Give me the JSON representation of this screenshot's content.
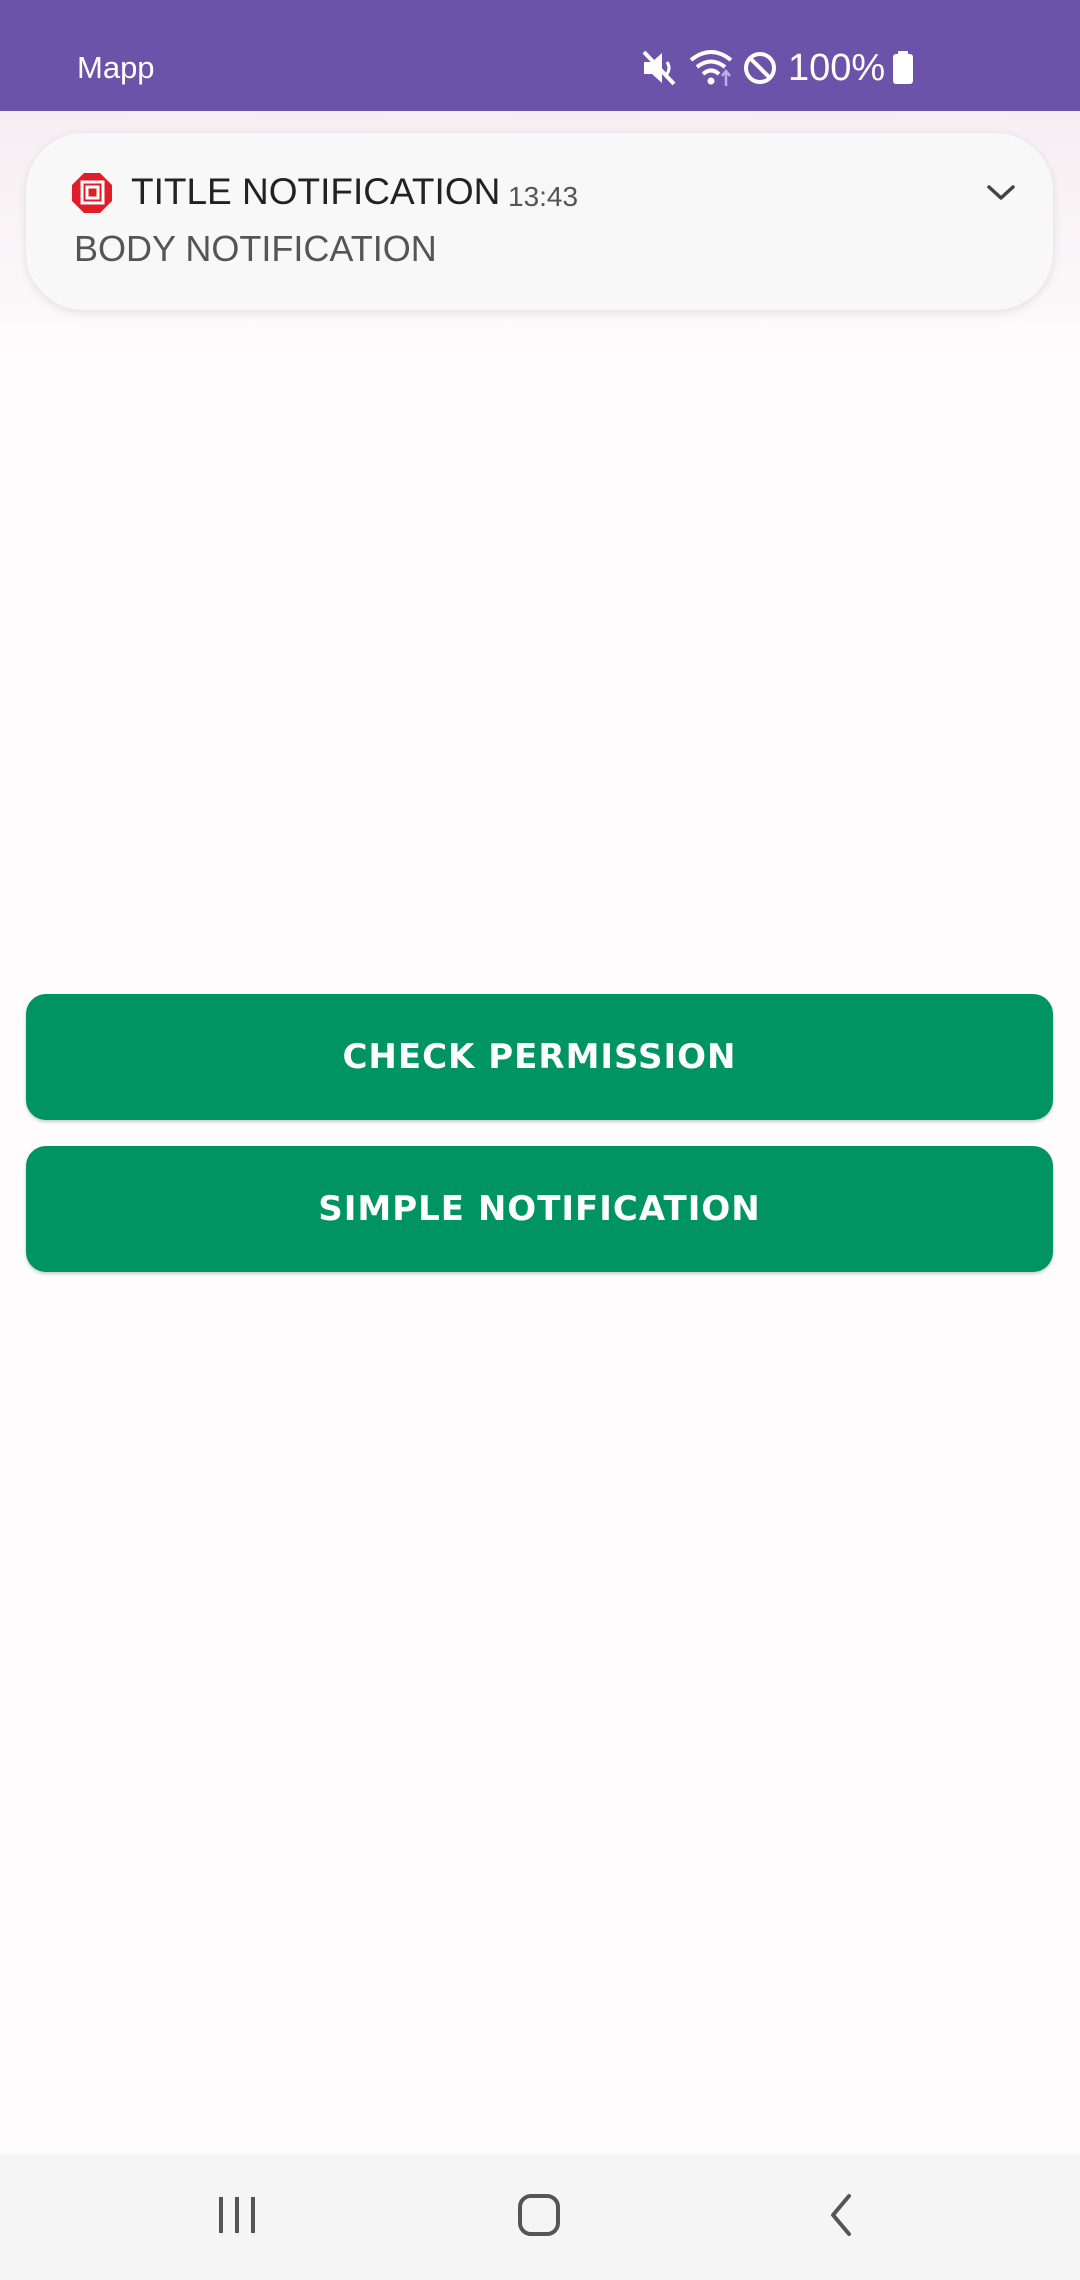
{
  "status_bar": {
    "app_name": "Mapp",
    "battery": "100%",
    "icons": [
      "mute-icon",
      "wifi-icon",
      "do-not-disturb-icon",
      "battery-icon"
    ],
    "background": "#6a53a8"
  },
  "notification": {
    "app_icon": "app-logo-icon",
    "title": "TITLE NOTIFICATION",
    "time": "13:43",
    "body": "BODY NOTIFICATION",
    "expand_icon": "chevron-down-icon"
  },
  "buttons": {
    "check_permission": "CHECK PERMISSION",
    "simple_notification": "SIMPLE NOTIFICATION",
    "color": "#009463"
  },
  "nav_bar": {
    "icons": [
      "recent-apps-icon",
      "home-icon",
      "back-icon"
    ]
  }
}
